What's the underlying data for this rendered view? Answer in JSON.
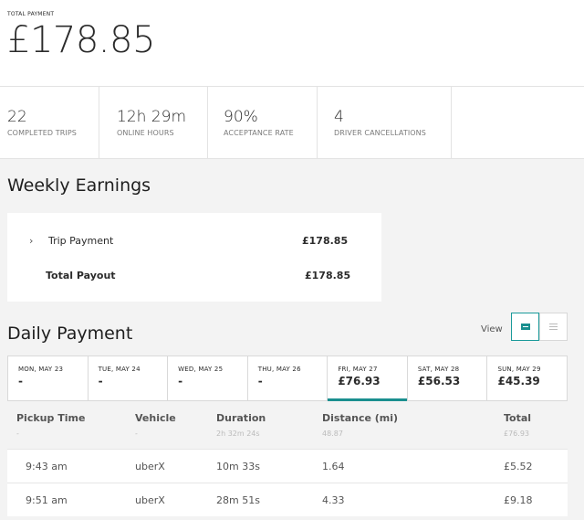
{
  "total_payment": {
    "label": "TOTAL PAYMENT",
    "amount": "£178.85"
  },
  "stats": [
    {
      "value": "22",
      "caption": "COMPLETED TRIPS"
    },
    {
      "value": "12h 29m",
      "caption": "ONLINE HOURS"
    },
    {
      "value": "90%",
      "caption": "ACCEPTANCE RATE"
    },
    {
      "value": "4",
      "caption": "DRIVER CANCELLATIONS"
    }
  ],
  "weekly": {
    "title": "Weekly Earnings",
    "trip_payment": {
      "chevron": "›",
      "label": "Trip Payment",
      "amount": "£178.85"
    },
    "total_payout": {
      "label": "Total Payout",
      "amount": "£178.85"
    }
  },
  "daily": {
    "title": "Daily Payment",
    "view_label": "View",
    "view_modes": [
      "card-view-icon",
      "list-view-icon"
    ],
    "accent_color": "#1a8f8f",
    "days": [
      {
        "name": "MON, MAY 23",
        "value": "-"
      },
      {
        "name": "TUE, MAY 24",
        "value": "-"
      },
      {
        "name": "WED, MAY 25",
        "value": "-"
      },
      {
        "name": "THU, MAY 26",
        "value": "-"
      },
      {
        "name": "FRI, MAY 27",
        "value": "£76.93"
      },
      {
        "name": "SAT, MAY 28",
        "value": "£56.53"
      },
      {
        "name": "SUN, MAY 29",
        "value": "£45.39"
      }
    ],
    "selected_day": "FRI, MAY 27"
  },
  "table": {
    "headers": [
      "Pickup Time",
      "Vehicle",
      "Duration",
      "Distance (mi)",
      "Total"
    ],
    "summary": [
      "-",
      "-",
      "2h 32m 24s",
      "48.87",
      "£76.93"
    ],
    "rows": [
      [
        "9:43 am",
        "uberX",
        "10m 33s",
        "1.64",
        "£5.52"
      ],
      [
        "9:51 am",
        "uberX",
        "28m 51s",
        "4.33",
        "£9.18"
      ]
    ]
  }
}
